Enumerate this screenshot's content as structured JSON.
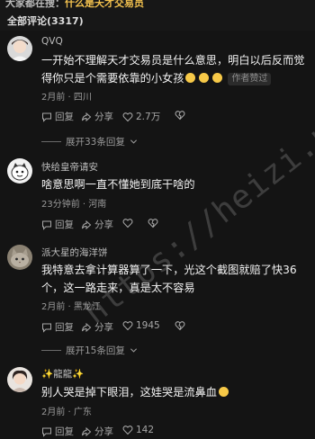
{
  "top_hint": {
    "prefix": "大家都在搜：",
    "highlight": "什么是天才交易员"
  },
  "header": {
    "title": "全部评论(3317)"
  },
  "comments": [
    {
      "user": "QVQ",
      "text": "一开始不理解天才交易员是什么意思，明白以后反而觉得你只是个需要依靠的小女孩",
      "badge": "作者赞过",
      "meta": "2月前 · 四川",
      "reply": "回复",
      "share": "分享",
      "likes": "2.7万",
      "expand": "展开33条回复",
      "avatar_icon": "user-avatar-girl"
    },
    {
      "user": "快给皇帝请安",
      "text": "啥意思啊一直不懂她到底干啥的",
      "meta": "23分钟前 · 河南",
      "reply": "回复",
      "share": "分享",
      "likes": "",
      "avatar_icon": "user-avatar-cartoon"
    },
    {
      "user": "派大星的海洋饼",
      "text": "我特意去拿计算器算了一下，光这个截图就赔了快36个，这一路走来，真是太不容易",
      "meta": "2月前 · 黑龙江",
      "reply": "回复",
      "share": "分享",
      "likes": "1945",
      "expand": "展开15条回复",
      "avatar_icon": "user-avatar-cat"
    },
    {
      "user": "✨龍龍✨",
      "text": "别人哭是掉下眼泪，这娃哭是流鼻血",
      "meta": "2月前 · 广东",
      "reply": "回复",
      "share": "分享",
      "likes": "142",
      "avatar_icon": "user-avatar-girl-2"
    }
  ],
  "watermark": "https://heizi.pw",
  "colors": {
    "background": "#141414",
    "highlight": "#f2c14e",
    "emoji": "#f7c948"
  }
}
